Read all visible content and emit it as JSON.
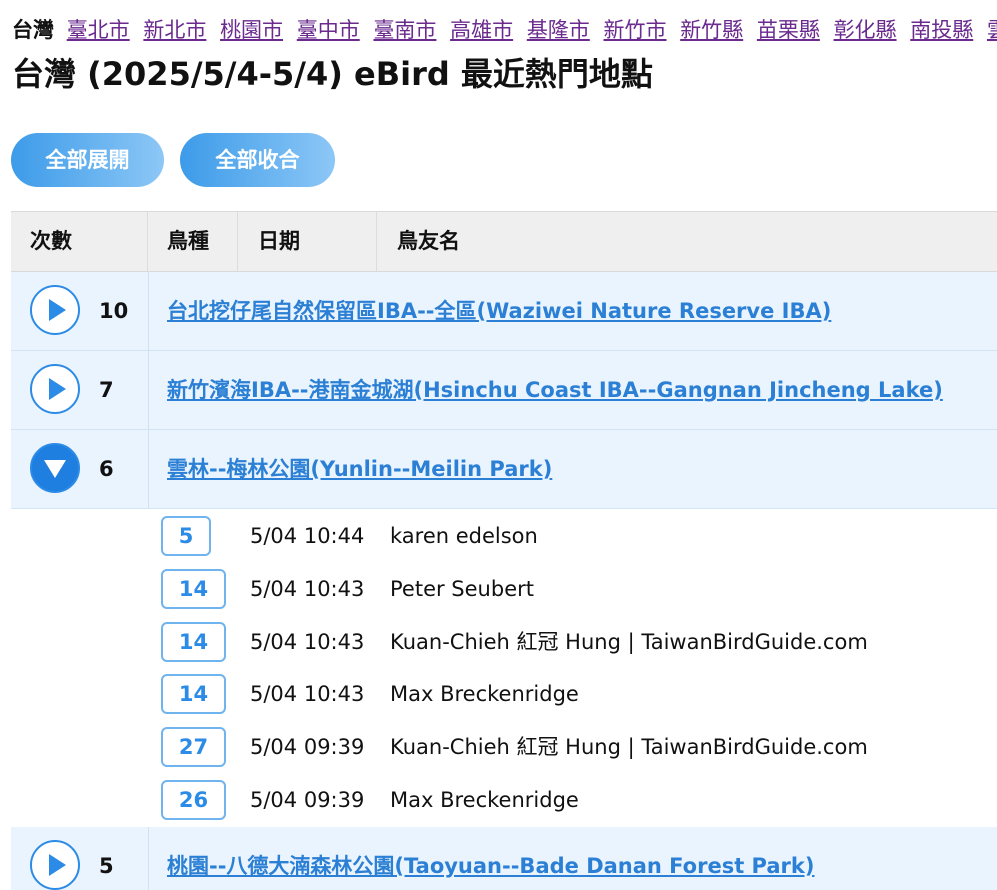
{
  "regions": {
    "country": "台灣",
    "links": [
      "臺北市",
      "新北市",
      "桃園市",
      "臺中市",
      "臺南市",
      "高雄市",
      "基隆市",
      "新竹市",
      "新竹縣",
      "苗栗縣",
      "彰化縣",
      "南投縣",
      "雲"
    ]
  },
  "page_title": "台灣 (2025/5/4-5/4) eBird 最近熱門地點",
  "buttons": {
    "expand_all": "全部展開",
    "collapse_all": "全部收合"
  },
  "table": {
    "headers": {
      "count": "次數",
      "species": "鳥種",
      "date": "日期",
      "birder": "鳥友名"
    },
    "locations": [
      {
        "count": "10",
        "name": "台北挖仔尾自然保留區IBA--全區(Waziwei Nature Reserve IBA)",
        "expanded": false
      },
      {
        "count": "7",
        "name": "新竹濱海IBA--港南金城湖(Hsinchu Coast IBA--Gangnan Jincheng Lake)",
        "expanded": false
      },
      {
        "count": "6",
        "name": "雲林--梅林公園(Yunlin--Meilin Park)",
        "expanded": true
      },
      {
        "count": "5",
        "name": "桃園--八德大湳森林公園(Taoyuan--Bade Danan Forest Park)",
        "expanded": false
      }
    ],
    "checklists": [
      {
        "species": "5",
        "date": "5/04 10:44",
        "birder": "karen edelson"
      },
      {
        "species": "14",
        "date": "5/04 10:43",
        "birder": "Peter Seubert"
      },
      {
        "species": "14",
        "date": "5/04 10:43",
        "birder": "Kuan-Chieh 紅冠 Hung | TaiwanBirdGuide.com"
      },
      {
        "species": "14",
        "date": "5/04 10:43",
        "birder": "Max Breckenridge"
      },
      {
        "species": "27",
        "date": "5/04 09:39",
        "birder": "Kuan-Chieh 紅冠 Hung | TaiwanBirdGuide.com"
      },
      {
        "species": "26",
        "date": "5/04 09:39",
        "birder": "Max Breckenridge"
      }
    ]
  },
  "colors": {
    "accent": "#2b8be6",
    "row_bg": "#eaf4fe",
    "link_visited": "#6a2a8e"
  }
}
